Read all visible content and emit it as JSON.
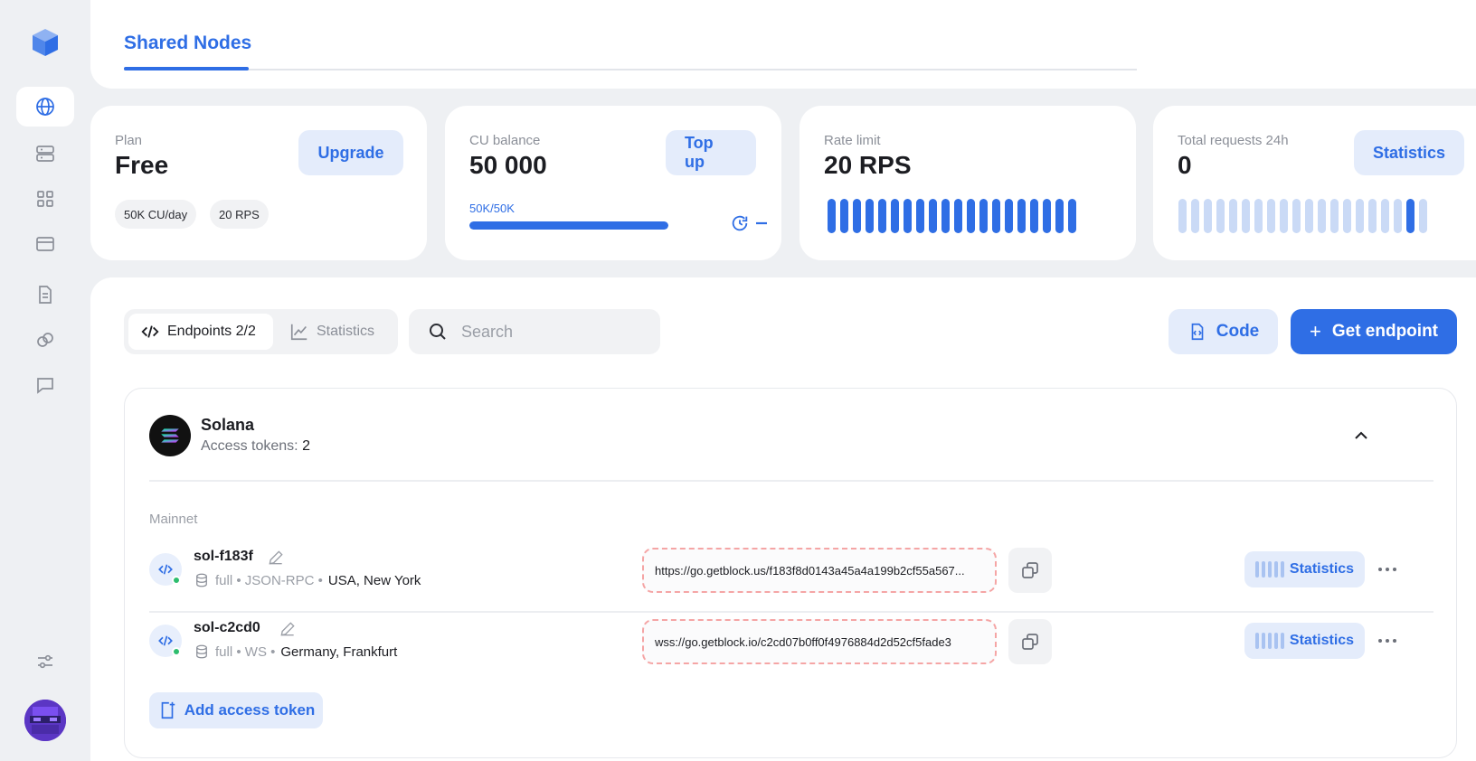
{
  "nav": {
    "items": [
      "globe",
      "server",
      "grid",
      "card",
      "document",
      "link",
      "chat"
    ],
    "active": "globe"
  },
  "header": {
    "tab": "Shared Nodes"
  },
  "stats": {
    "plan": {
      "label": "Plan",
      "value": "Free",
      "button": "Upgrade",
      "chips": [
        "50K CU/day",
        "20 RPS"
      ]
    },
    "balance": {
      "label": "CU balance",
      "value": "50 000",
      "button": "Top up",
      "used_text": "50K/50K",
      "fill_fraction": 1.0
    },
    "rate": {
      "label": "Rate limit",
      "value": "20 RPS",
      "bars": 20
    },
    "requests": {
      "label": "Total requests 24h",
      "value": "0",
      "button": "Statistics",
      "bars": 20,
      "highlight_bar": 18
    }
  },
  "toolbar": {
    "tab_endpoints": "Endpoints 2/2",
    "tab_statistics": "Statistics",
    "search_placeholder": "Search",
    "code_button": "Code",
    "get_endpoint_button": "Get endpoint"
  },
  "network": {
    "name": "Solana",
    "tokens_label": "Access tokens:",
    "tokens_count": "2",
    "section": "Mainnet",
    "endpoints": [
      {
        "name": "sol-f183f",
        "mode": "full",
        "protocol": "JSON-RPC",
        "location": "USA, New York",
        "url": "https://go.getblock.us/f183f8d0143a45a4a199b2cf55a567...",
        "stat_button": "Statistics"
      },
      {
        "name": "sol-c2cd0",
        "mode": "full",
        "protocol": "WS",
        "location": "Germany, Frankfurt",
        "url": "wss://go.getblock.io/c2cd07b0ff0f4976884d2d52cf5fade3",
        "stat_button": "Statistics"
      }
    ],
    "add_token_button": "Add access token"
  },
  "colors": {
    "accent": "#2f6ee5",
    "accent_light": "#e4ecfb",
    "bar_light": "#cadaf6",
    "online": "#2dbd6e"
  }
}
